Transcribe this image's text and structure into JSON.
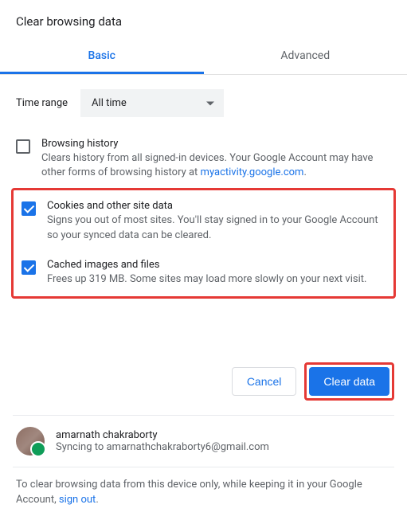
{
  "title": "Clear browsing data",
  "tabs": {
    "basic": "Basic",
    "advanced": "Advanced"
  },
  "time": {
    "label": "Time range",
    "value": "All time"
  },
  "opts": {
    "bh": {
      "title": "Browsing history",
      "desc_a": "Clears history from all signed-in devices. Your Google Account may have other forms of browsing history at ",
      "link": "myactivity.google.com",
      "desc_b": "."
    },
    "ck": {
      "title": "Cookies and other site data",
      "desc": "Signs you out of most sites. You'll stay signed in to your Google Account so your synced data can be cleared."
    },
    "ci": {
      "title": "Cached images and files",
      "desc": "Frees up 319 MB. Some sites may load more slowly on your next visit."
    }
  },
  "actions": {
    "cancel": "Cancel",
    "clear": "Clear data"
  },
  "sync": {
    "name": "amarnath chakraborty",
    "email": "Syncing to amarnathchakraborty6@gmail.com"
  },
  "foot": {
    "a": "To clear browsing data from this device only, while keeping it in your Google Account, ",
    "link": "sign out",
    "b": "."
  }
}
